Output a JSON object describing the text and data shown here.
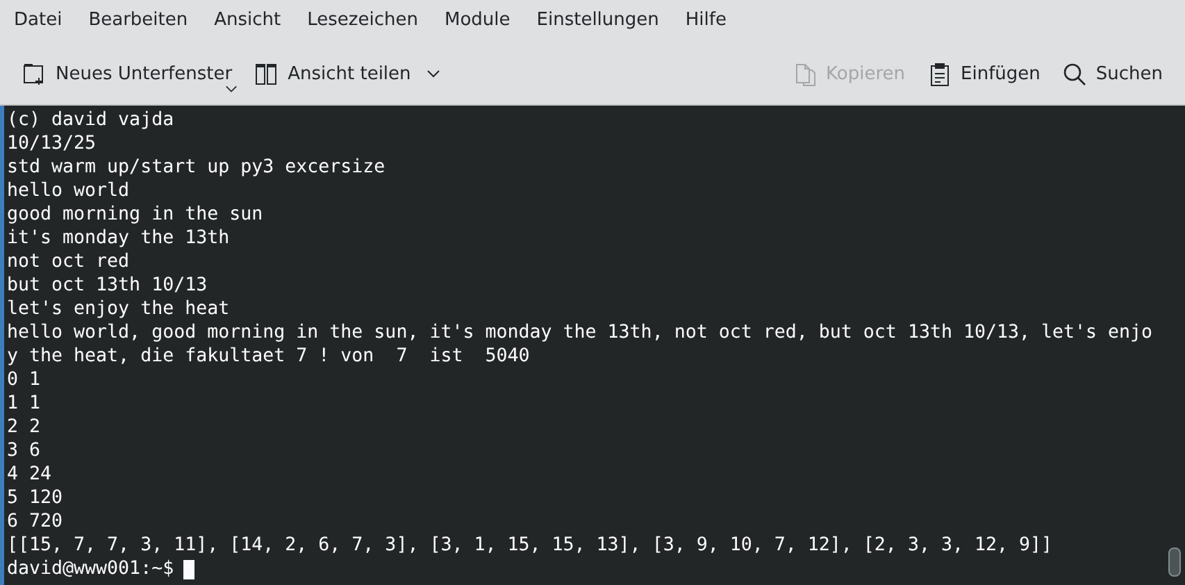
{
  "menu": [
    "Datei",
    "Bearbeiten",
    "Ansicht",
    "Lesezeichen",
    "Module",
    "Einstellungen",
    "Hilfe"
  ],
  "toolbar": [
    {
      "label": "Neues Unterfenster",
      "disabled": false
    },
    {
      "label": "Ansicht teilen",
      "disabled": false
    },
    {
      "label": "Kopieren",
      "disabled": true
    },
    {
      "label": "Einfügen",
      "disabled": false
    },
    {
      "label": "Suchen",
      "disabled": false
    }
  ],
  "terminal": {
    "lines": [
      "(c) david vajda",
      "10/13/25",
      "std warm up/start up py3 excersize",
      "hello world",
      "good morning in the sun",
      "it's monday the 13th",
      "not oct red",
      "but oct 13th 10/13",
      "let's enjoy the heat",
      "hello world, good morning in the sun, it's monday the 13th, not oct red, but oct 13th 10/13, let's enjo",
      "y the heat, die fakultaet 7 ! von  7  ist  5040",
      "0 1",
      "1 1",
      "2 2",
      "3 6",
      "4 24",
      "5 120",
      "6 720",
      "[[15, 7, 7, 3, 11], [14, 2, 6, 7, 3], [3, 1, 15, 15, 13], [3, 9, 10, 7, 12], [2, 3, 3, 12, 9]]"
    ],
    "prompt": "david@www001:~$",
    "cursor": true
  }
}
